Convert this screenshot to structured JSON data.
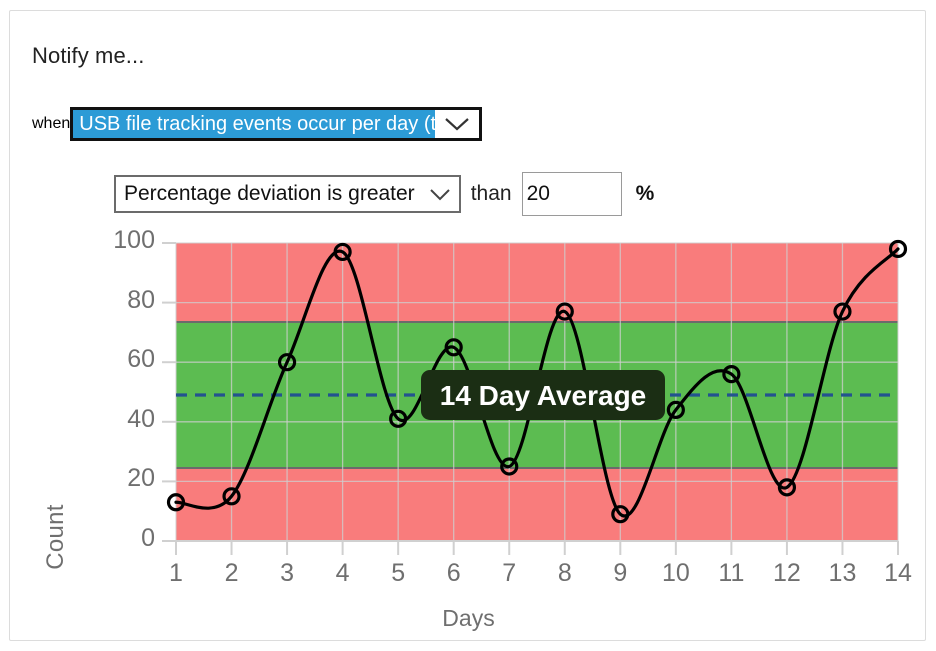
{
  "card": {
    "title": "Notify me...",
    "when_label": "when",
    "than_label": "than",
    "percent_label": "%"
  },
  "metric_select": {
    "name": "metric-select",
    "value": "USB file tracking events occur per day (total).",
    "icon": "chevron-down-icon",
    "selected_bg": "#2c9bd6",
    "selected_fg": "#ffffff"
  },
  "condition_select": {
    "name": "condition-select",
    "value": "Percentage deviation is greater",
    "icon": "chevron-down-icon"
  },
  "threshold_input": {
    "name": "threshold-input",
    "value": "20",
    "placeholder": ""
  },
  "chart_data": {
    "type": "line",
    "title": "",
    "xlabel": "Days",
    "ylabel": "Count",
    "x": [
      1,
      2,
      3,
      4,
      5,
      6,
      7,
      8,
      9,
      10,
      11,
      12,
      13,
      14
    ],
    "xticklabels": [
      "1",
      "2",
      "3",
      "4",
      "5",
      "6",
      "7",
      "8",
      "9",
      "10",
      "11",
      "12",
      "13",
      "14"
    ],
    "values": [
      13,
      15,
      60,
      97,
      41,
      65,
      25,
      77,
      9,
      44,
      56,
      18,
      77,
      98
    ],
    "series": [
      {
        "name": "Count",
        "values": [
          13,
          15,
          60,
          97,
          41,
          65,
          25,
          77,
          9,
          44,
          56,
          18,
          77,
          98
        ],
        "color": "#000000",
        "marker": "open-circle",
        "smooth": true
      }
    ],
    "yticklabels": [
      "0",
      "20",
      "40",
      "60",
      "80",
      "100"
    ],
    "yticks": [
      0,
      20,
      40,
      60,
      80,
      100
    ],
    "ylim": [
      0,
      100
    ],
    "xlim": [
      1,
      14
    ],
    "grid": true,
    "grid_color": "#d9d9d9",
    "legend": "none",
    "average_line": {
      "label": "14 Day Average",
      "value": 49,
      "color": "#23538f",
      "style": "dashed",
      "tooltip_bg": "#1b2e14",
      "tooltip_fg": "#ffffff"
    },
    "bands": [
      {
        "name": "out-of-range-low",
        "from": 0,
        "to": 24.5,
        "color": "#f97c7c"
      },
      {
        "name": "in-range",
        "from": 24.5,
        "to": 73.5,
        "color": "#5cbc51"
      },
      {
        "name": "out-of-range-high",
        "from": 73.5,
        "to": 100,
        "color": "#f97c7c"
      }
    ]
  }
}
